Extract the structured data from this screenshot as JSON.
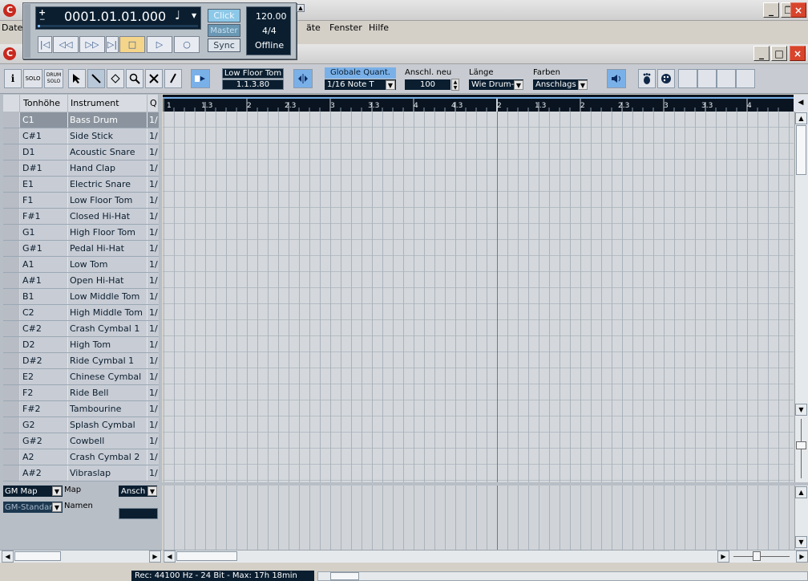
{
  "menubar": {
    "items": [
      "Date",
      "äte",
      "Fenster",
      "Hilfe"
    ]
  },
  "transport": {
    "position": "0001.01.01.000",
    "plus_minus": [
      "+",
      "−"
    ],
    "click_label": "Click",
    "master_label": "Master",
    "sync_label": "Sync",
    "tempo": "120.00",
    "signature": "4/4",
    "status": "Offline"
  },
  "toolbar": {
    "info_label": "i",
    "solo_label": "SOLO",
    "drum_solo_label": "DRUM SOLO",
    "instrument_name": "Low Floor Tom",
    "instrument_position": "1.1.3.80",
    "quant_label": "Globale Quant.",
    "quant_value": "1/16 Note T",
    "velocity_label": "Anschl. neu",
    "velocity_value": "100",
    "length_label": "Länge",
    "length_value": "Wie Drum-",
    "colors_label": "Farben",
    "colors_value": "Anschlags"
  },
  "list": {
    "col_pitch": "Tonhöhe",
    "col_instrument": "Instrument",
    "col_q": "Q",
    "rows": [
      {
        "pitch": "C1",
        "instrument": "Bass Drum",
        "q": "1/"
      },
      {
        "pitch": "C#1",
        "instrument": "Side Stick",
        "q": "1/"
      },
      {
        "pitch": "D1",
        "instrument": "Acoustic Snare",
        "q": "1/"
      },
      {
        "pitch": "D#1",
        "instrument": "Hand Clap",
        "q": "1/"
      },
      {
        "pitch": "E1",
        "instrument": "Electric Snare",
        "q": "1/"
      },
      {
        "pitch": "F1",
        "instrument": "Low Floor Tom",
        "q": "1/"
      },
      {
        "pitch": "F#1",
        "instrument": "Closed Hi-Hat",
        "q": "1/"
      },
      {
        "pitch": "G1",
        "instrument": "High Floor Tom",
        "q": "1/"
      },
      {
        "pitch": "G#1",
        "instrument": "Pedal Hi-Hat",
        "q": "1/"
      },
      {
        "pitch": "A1",
        "instrument": "Low Tom",
        "q": "1/"
      },
      {
        "pitch": "A#1",
        "instrument": "Open Hi-Hat",
        "q": "1/"
      },
      {
        "pitch": "B1",
        "instrument": "Low Middle Tom",
        "q": "1/"
      },
      {
        "pitch": "C2",
        "instrument": "High Middle Tom",
        "q": "1/"
      },
      {
        "pitch": "C#2",
        "instrument": "Crash Cymbal 1",
        "q": "1/"
      },
      {
        "pitch": "D2",
        "instrument": "High Tom",
        "q": "1/"
      },
      {
        "pitch": "D#2",
        "instrument": "Ride Cymbal 1",
        "q": "1/"
      },
      {
        "pitch": "E2",
        "instrument": "Chinese Cymbal",
        "q": "1/"
      },
      {
        "pitch": "F2",
        "instrument": "Ride Bell",
        "q": "1/"
      },
      {
        "pitch": "F#2",
        "instrument": "Tambourine",
        "q": "1/"
      },
      {
        "pitch": "G2",
        "instrument": "Splash Cymbal",
        "q": "1/"
      },
      {
        "pitch": "G#2",
        "instrument": "Cowbell",
        "q": "1/"
      },
      {
        "pitch": "A2",
        "instrument": "Crash Cymbal 2",
        "q": "1/"
      },
      {
        "pitch": "A#2",
        "instrument": "Vibraslap",
        "q": "1/"
      }
    ]
  },
  "ruler": {
    "ticks": [
      "1",
      "1.3",
      "2",
      "2.3",
      "3",
      "3.3",
      "4",
      "4.3",
      "2",
      "1.3",
      "2",
      "2.3",
      "3",
      "3.3",
      "4"
    ]
  },
  "map": {
    "map_select": "GM Map",
    "map_label": "Map",
    "ansch_select": "Ansch",
    "names_select": "GM-Standar",
    "names_label": "Namen"
  },
  "statusbar": {
    "rec_info": "Rec: 44100 Hz - 24 Bit - Max: 17h 18min"
  }
}
